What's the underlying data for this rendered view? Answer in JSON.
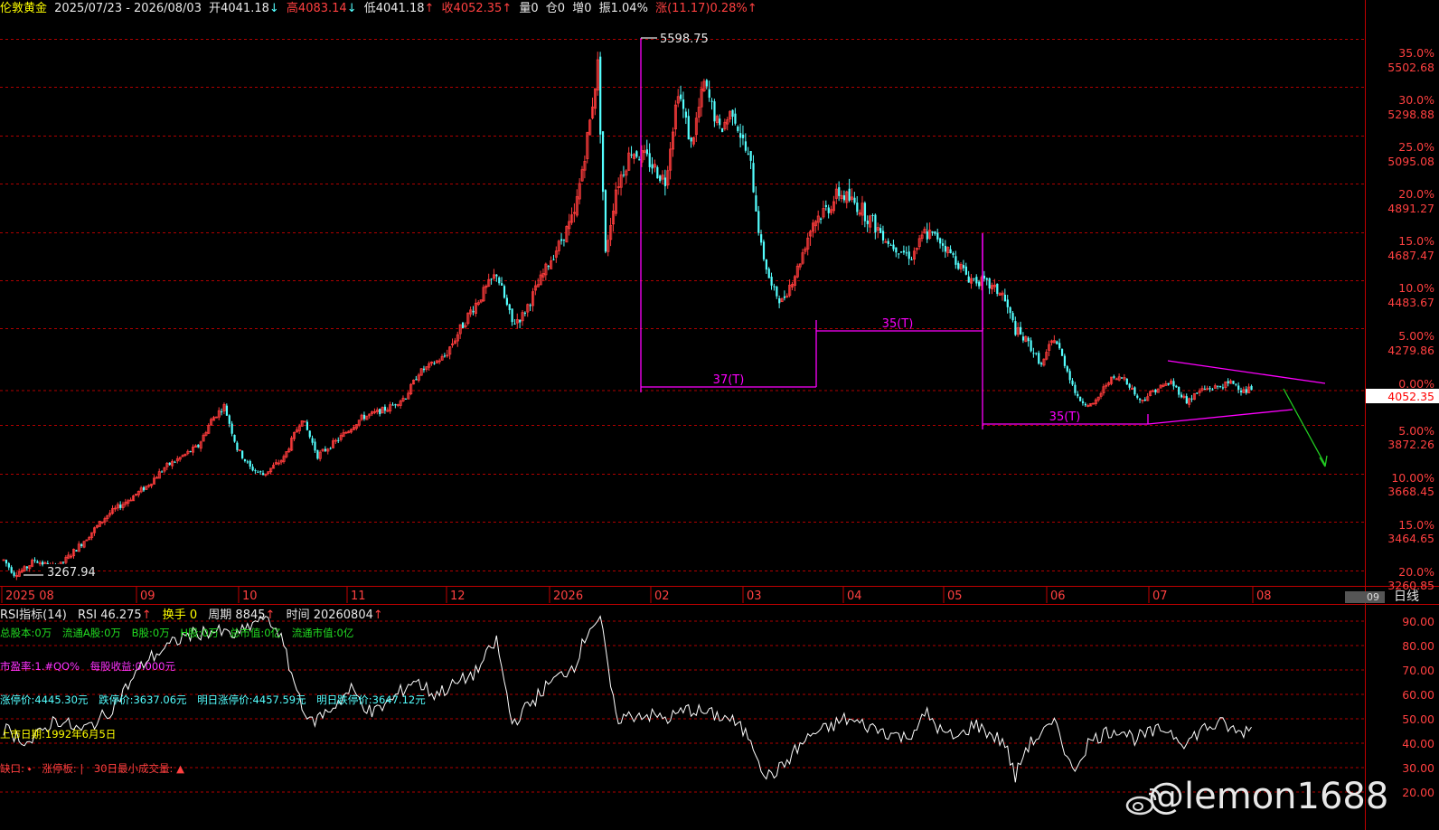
{
  "header": {
    "name": "伦敦黄金",
    "range": "2025/07/23 - 2026/08/03",
    "open": "开4041.18",
    "open_arrow": "↓",
    "high": "高4083.14",
    "high_arrow": "↓",
    "low": "低4041.18",
    "low_arrow": "↑",
    "close": "收4052.35",
    "close_arrow": "↑",
    "volume": "量0",
    "position": "仓0",
    "increase": "增0",
    "amplitude": "振1.04%",
    "change": "涨(11.17)0.28%",
    "change_arrow": "↑"
  },
  "indicator_header": {
    "name": "RSI指标(14)",
    "rsi": "RSI 46.275",
    "rsi_arrow": "↑",
    "turnover": "换手 0",
    "period": "周期 8845",
    "period_arrow": "↑",
    "time": "时间 20260804",
    "time_arrow": "↑"
  },
  "info_lines": {
    "line1": [
      "总股本:0万",
      "流通A股:0万",
      "B股:0万",
      "H股:0万",
      "总市值:0亿",
      "流通市值:0亿"
    ],
    "line2": [
      "市盈率:1.#QO%",
      "每股收益:0.000元"
    ],
    "line3": [
      "涨停价:4445.30元",
      "跌停价:3637.06元",
      "明日涨停价:4457.59元",
      "明日跌停价:3647.12元"
    ],
    "line4": [
      "上市日期:1992年6月5日"
    ],
    "line5": [
      "缺口: ",
      "涨停板: ",
      "30日最小成交量: "
    ]
  },
  "period_label": "日线",
  "scroll_label": "09",
  "watermark": "@lemon1688",
  "colors": {
    "up": "#ff3c3c",
    "down": "#54ffff",
    "grid": "#b00000",
    "axis_text": "#ff4040",
    "drawing": "#ff00ff",
    "arrow": "#22cc22",
    "rsi_line": "#ffffff",
    "last_price_bg": "#ffffff",
    "last_price_text": "#ff0000"
  },
  "chart_data": [
    {
      "type": "candlestick",
      "title": "伦敦黄金",
      "price_labels": [
        "5502.68",
        "5298.88",
        "5095.08",
        "4891.27",
        "4687.47",
        "4483.67",
        "4279.86",
        "4052.35",
        "3872.26",
        "3668.45",
        "3464.65",
        "3260.85"
      ],
      "price_values": [
        5502.68,
        5298.88,
        5095.08,
        4891.27,
        4687.47,
        4483.67,
        4279.86,
        4052.35,
        3872.26,
        3668.45,
        3464.65,
        3260.85
      ],
      "percent_labels": [
        "35.0%",
        "30.0%",
        "25.0%",
        "20.0%",
        "15.0%",
        "10.0%",
        "5.00%",
        "0.00%",
        "5.00%",
        "10.00%",
        "15.0%",
        "20.0%"
      ],
      "x_ticks": [
        "2025 08",
        "09",
        "10",
        "11",
        "12",
        "2026",
        "02",
        "03",
        "04",
        "05",
        "06",
        "07",
        "08"
      ],
      "last_price": "4052.35",
      "annotations": {
        "high": "5598.75",
        "low": "3267.94",
        "cycles": [
          "37(T)",
          "35(T)",
          "35(T)"
        ]
      },
      "trend_keypoints": [
        [
          0,
          3330
        ],
        [
          4,
          3272
        ],
        [
          8,
          3290
        ],
        [
          12,
          3330
        ],
        [
          18,
          3300
        ],
        [
          22,
          3310
        ],
        [
          30,
          3400
        ],
        [
          40,
          3520
        ],
        [
          55,
          3640
        ],
        [
          62,
          3720
        ],
        [
          75,
          3810
        ],
        [
          80,
          3920
        ],
        [
          85,
          3980
        ],
        [
          90,
          3800
        ],
        [
          95,
          3720
        ],
        [
          100,
          3690
        ],
        [
          108,
          3760
        ],
        [
          115,
          3930
        ],
        [
          121,
          3770
        ],
        [
          128,
          3830
        ],
        [
          138,
          3930
        ],
        [
          148,
          3970
        ],
        [
          155,
          4020
        ],
        [
          160,
          4120
        ],
        [
          170,
          4190
        ],
        [
          180,
          4380
        ],
        [
          190,
          4540
        ],
        [
          196,
          4330
        ],
        [
          200,
          4360
        ],
        [
          210,
          4580
        ],
        [
          220,
          4780
        ],
        [
          226,
          5180
        ],
        [
          229,
          5420
        ],
        [
          232,
          4620
        ],
        [
          236,
          4900
        ],
        [
          242,
          5060
        ],
        [
          248,
          5020
        ],
        [
          255,
          4930
        ],
        [
          260,
          5320
        ],
        [
          265,
          5080
        ],
        [
          270,
          5340
        ],
        [
          276,
          5140
        ],
        [
          281,
          5230
        ],
        [
          288,
          4990
        ],
        [
          292,
          4650
        ],
        [
          296,
          4480
        ],
        [
          300,
          4420
        ],
        [
          306,
          4560
        ],
        [
          312,
          4760
        ],
        [
          318,
          4820
        ],
        [
          322,
          4880
        ],
        [
          330,
          4820
        ],
        [
          336,
          4740
        ],
        [
          342,
          4660
        ],
        [
          350,
          4610
        ],
        [
          355,
          4710
        ],
        [
          360,
          4690
        ],
        [
          366,
          4610
        ],
        [
          372,
          4520
        ],
        [
          378,
          4500
        ],
        [
          385,
          4450
        ],
        [
          390,
          4300
        ],
        [
          396,
          4230
        ],
        [
          400,
          4150
        ],
        [
          405,
          4270
        ],
        [
          410,
          4130
        ],
        [
          414,
          4010
        ],
        [
          420,
          3980
        ],
        [
          426,
          4090
        ],
        [
          432,
          4100
        ],
        [
          438,
          4000
        ],
        [
          444,
          4050
        ],
        [
          450,
          4080
        ],
        [
          456,
          4000
        ],
        [
          462,
          4050
        ],
        [
          468,
          4060
        ],
        [
          474,
          4080
        ],
        [
          478,
          4040
        ],
        [
          481,
          4052.35
        ]
      ]
    },
    {
      "type": "line",
      "title": "RSI指标(14)",
      "y_labels": [
        "90.00",
        "80.00",
        "70.00",
        "60.00",
        "50.00",
        "40.00",
        "30.00",
        "20.00"
      ],
      "y_values": [
        90,
        80,
        70,
        60,
        50,
        40,
        30,
        20
      ],
      "ylim": [
        18,
        94
      ],
      "series": [
        {
          "name": "RSI",
          "keypoints": [
            [
              0,
              46
            ],
            [
              10,
              40
            ],
            [
              20,
              50
            ],
            [
              30,
              45
            ],
            [
              40,
              52
            ],
            [
              55,
              74
            ],
            [
              70,
              84
            ],
            [
              80,
              86
            ],
            [
              90,
              84
            ],
            [
              100,
              92
            ],
            [
              106,
              86
            ],
            [
              112,
              65
            ],
            [
              118,
              48
            ],
            [
              126,
              54
            ],
            [
              134,
              62
            ],
            [
              142,
              52
            ],
            [
              150,
              58
            ],
            [
              158,
              66
            ],
            [
              166,
              60
            ],
            [
              174,
              64
            ],
            [
              182,
              69
            ],
            [
              190,
              82
            ],
            [
              196,
              48
            ],
            [
              202,
              55
            ],
            [
              210,
              64
            ],
            [
              220,
              72
            ],
            [
              226,
              88
            ],
            [
              230,
              91
            ],
            [
              236,
              50
            ],
            [
              246,
              52
            ],
            [
              256,
              50
            ],
            [
              264,
              54
            ],
            [
              272,
              52
            ],
            [
              280,
              50
            ],
            [
              288,
              42
            ],
            [
              294,
              26
            ],
            [
              300,
              30
            ],
            [
              306,
              38
            ],
            [
              312,
              44
            ],
            [
              318,
              46
            ],
            [
              324,
              50
            ],
            [
              330,
              48
            ],
            [
              336,
              46
            ],
            [
              342,
              44
            ],
            [
              348,
              42
            ],
            [
              356,
              52
            ],
            [
              362,
              44
            ],
            [
              368,
              42
            ],
            [
              374,
              48
            ],
            [
              380,
              44
            ],
            [
              386,
              40
            ],
            [
              390,
              26
            ],
            [
              394,
              38
            ],
            [
              400,
              44
            ],
            [
              406,
              48
            ],
            [
              412,
              28
            ],
            [
              418,
              40
            ],
            [
              424,
              44
            ],
            [
              430,
              46
            ],
            [
              436,
              42
            ],
            [
              442,
              44
            ],
            [
              448,
              46
            ],
            [
              456,
              40
            ],
            [
              462,
              46
            ],
            [
              470,
              48
            ],
            [
              476,
              44
            ],
            [
              481,
              46.3
            ]
          ]
        }
      ]
    }
  ]
}
